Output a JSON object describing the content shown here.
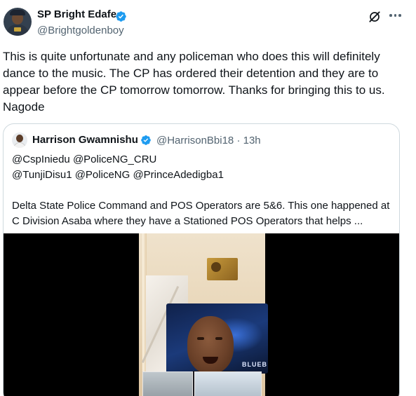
{
  "author": {
    "name": "SP Bright Edafe",
    "handle": "@Brightgoldenboy"
  },
  "tweet": {
    "text": "This is quite unfortunate and any policeman who does this will definitely dance to the music. The CP has ordered their detention and they are to appear before the CP tomorrow tomorrow. Thanks for bringing this to us. Nagode"
  },
  "quoted": {
    "name": "Harrison Gwamnishu",
    "handle": "@HarrisonBbi18",
    "separator": "·",
    "time": "13h",
    "line1": "@CspIniedu @PoliceNG_CRU",
    "line2": "@TunjiDisu1 @PoliceNG @PrinceAdedigba1",
    "line3": "Delta State Police Command and POS Operators are 5&6. This one happened at C Division Asaba where they have a Stationed POS Operators that helps ...",
    "media_overlay_text": "BLUEB"
  },
  "colors": {
    "verified": "#1d9bf0",
    "secondary_text": "#536471",
    "border": "#cfd9de"
  },
  "icons": {
    "verified": "verified-badge-icon",
    "grok": "grok-icon",
    "more": "more-icon"
  }
}
